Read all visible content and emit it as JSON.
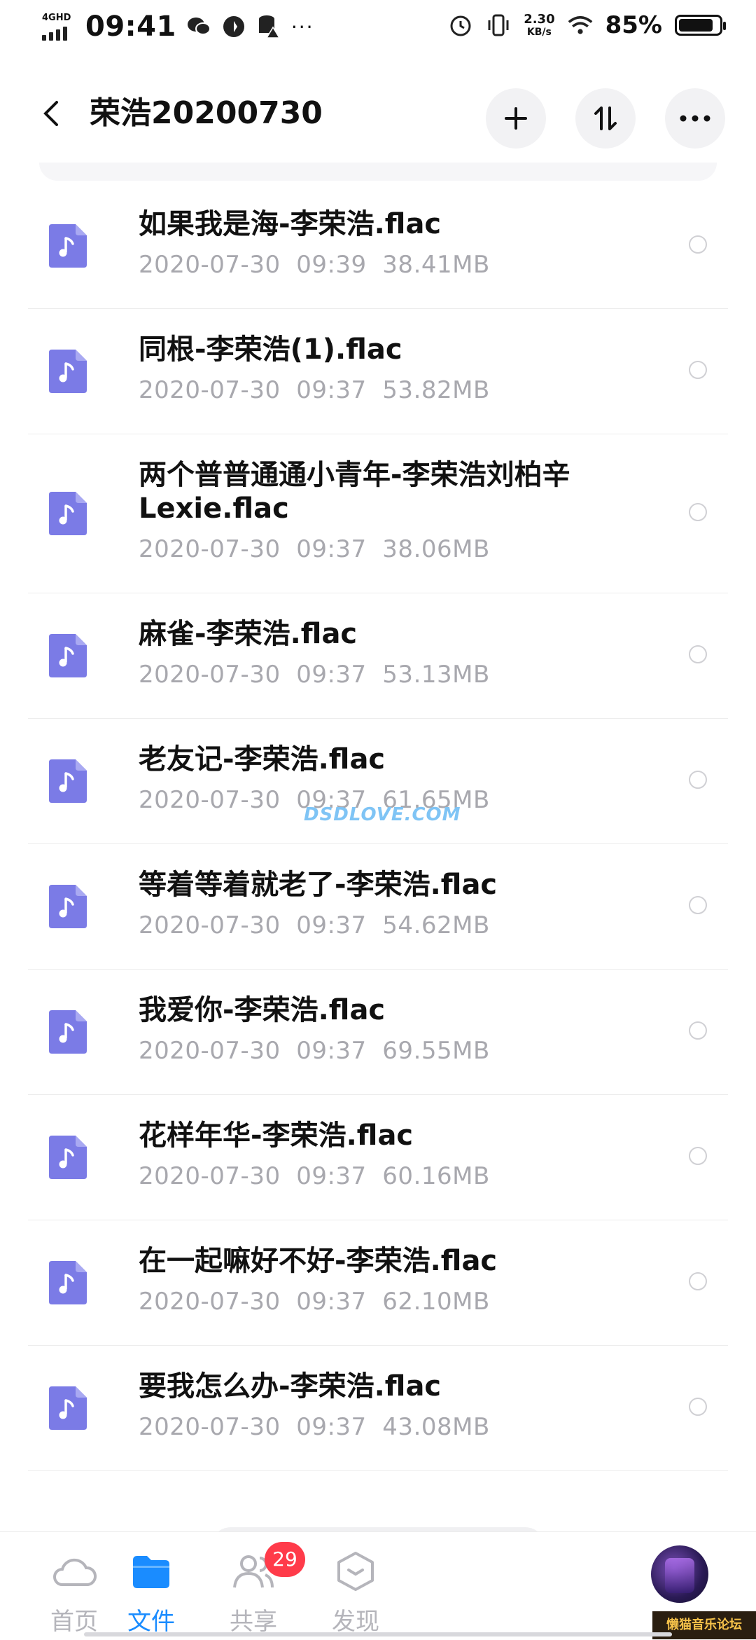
{
  "status_bar": {
    "network": "4GHD",
    "time": "09:41",
    "more": "···",
    "speed_value": "2.30",
    "speed_unit": "KB/s",
    "battery_percent": "85%",
    "battery_level": 0.85
  },
  "header": {
    "title": "荣浩20200730",
    "add_label": "+",
    "sort_label": "⇅",
    "more_label": "···"
  },
  "files": [
    {
      "name": "如果我是海-李荣浩.flac",
      "meta": "2020-07-30  09:39  38.41MB"
    },
    {
      "name": "同根-李荣浩(1).flac",
      "meta": "2020-07-30  09:37  53.82MB"
    },
    {
      "name": "两个普普通通小青年-李荣浩刘柏辛Lexie.flac",
      "meta": "2020-07-30  09:37  38.06MB"
    },
    {
      "name": "麻雀-李荣浩.flac",
      "meta": "2020-07-30  09:37  53.13MB"
    },
    {
      "name": "老友记-李荣浩.flac",
      "meta": "2020-07-30  09:37  61.65MB"
    },
    {
      "name": "等着等着就老了-李荣浩.flac",
      "meta": "2020-07-30  09:37  54.62MB"
    },
    {
      "name": "我爱你-李荣浩.flac",
      "meta": "2020-07-30  09:37  69.55MB"
    },
    {
      "name": "花样年华-李荣浩.flac",
      "meta": "2020-07-30  09:37  60.16MB"
    },
    {
      "name": "在一起嘛好不好-李荣浩.flac",
      "meta": "2020-07-30  09:37  62.10MB"
    },
    {
      "name": "要我怎么办-李荣浩.flac",
      "meta": "2020-07-30  09:37  43.08MB"
    }
  ],
  "watermark": "DSDLOVE.COM",
  "tabs": [
    {
      "label": "首页",
      "icon": "cloud-icon"
    },
    {
      "label": "文件",
      "icon": "folder-icon",
      "active": true
    },
    {
      "label": "共享",
      "icon": "people-icon",
      "badge": "29"
    },
    {
      "label": "发现",
      "icon": "discover-icon"
    }
  ],
  "forum_tag": "懒猫音乐论坛",
  "colors": {
    "accent": "#1a8cff",
    "file_icon": "#7b7be6",
    "badge": "#ff3b4a",
    "meta_text": "#a8a8ae"
  }
}
